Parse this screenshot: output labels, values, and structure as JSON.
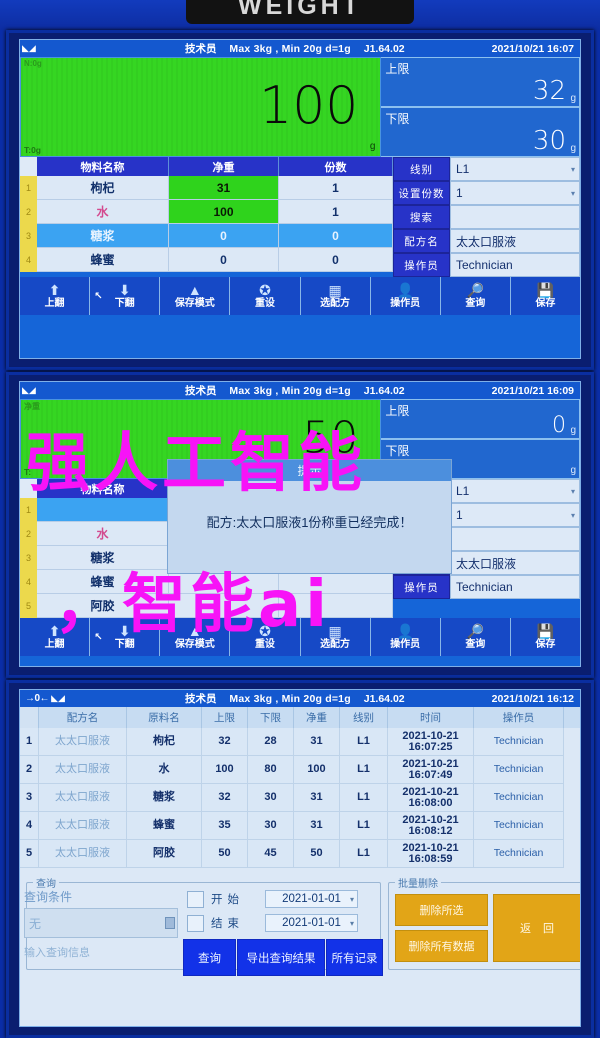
{
  "device": {
    "plate_label": "WEIGHT"
  },
  "common": {
    "status": {
      "zero_indicator": "→0←",
      "level_icon": "level-icon",
      "user": "技术员",
      "spec": "Max 3kg , Min 20g  d=1g",
      "version": "J1.64.02",
      "date": "2021/10/21"
    },
    "toolbar": [
      {
        "label": "上翻",
        "icon": "arrow-up-icon"
      },
      {
        "label": "下翻",
        "icon": "arrow-down-icon"
      },
      {
        "label": "保存模式",
        "icon": "stack-icon"
      },
      {
        "label": "重设",
        "icon": "refresh-icon"
      },
      {
        "label": "选配方",
        "icon": "grid-icon"
      },
      {
        "label": "操作员",
        "icon": "user-icon"
      },
      {
        "label": "查询",
        "icon": "search-doc-icon"
      },
      {
        "label": "保存",
        "icon": "save-plus-icon"
      }
    ],
    "table_headers": {
      "name": "物料名称",
      "net": "净重",
      "qty": "份数"
    },
    "limit_labels": {
      "upper": "上限",
      "lower": "下限"
    },
    "unit": "g",
    "form_labels": {
      "line": "线别",
      "portions": "设置份数",
      "search": "搜索",
      "recipe": "配方名",
      "operator": "操作员"
    }
  },
  "panel1": {
    "time": "16:07",
    "display": {
      "tare": "T:0g",
      "gross_hint": "N:0g",
      "value": "100",
      "unit": "g"
    },
    "limits": {
      "upper": "32",
      "lower": "30"
    },
    "form": {
      "line": "L1",
      "portions": "1",
      "search": "",
      "recipe": "太太口服液",
      "operator": "Technician"
    },
    "rows": [
      {
        "idx": "1",
        "name": "枸杞",
        "net": "31",
        "qty": "1",
        "net_green": true,
        "selected": false
      },
      {
        "idx": "2",
        "name": "水",
        "net": "100",
        "qty": "1",
        "net_green": true,
        "selected": false
      },
      {
        "idx": "3",
        "name": "糖浆",
        "net": "0",
        "qty": "0",
        "net_green": false,
        "selected": true
      },
      {
        "idx": "4",
        "name": "蜂蜜",
        "net": "0",
        "qty": "0",
        "net_green": false,
        "selected": false
      }
    ]
  },
  "panel2": {
    "time": "16:09",
    "display": {
      "tare": "T:",
      "gross_hint": "净重",
      "value": "50",
      "unit": "g"
    },
    "limits": {
      "upper": "0",
      "lower": ""
    },
    "form": {
      "line": "L1",
      "portions": "1",
      "search": "",
      "recipe": "太太口服液",
      "operator": "Technician"
    },
    "rows": [
      {
        "idx": "1",
        "name": "",
        "net": "",
        "qty": "",
        "selected": true
      },
      {
        "idx": "2",
        "name": "水",
        "net": "",
        "qty": "",
        "selected": false
      },
      {
        "idx": "3",
        "name": "糖浆",
        "net": "",
        "qty": "",
        "selected": false
      },
      {
        "idx": "4",
        "name": "蜂蜜",
        "net": "",
        "qty": "",
        "selected": false
      },
      {
        "idx": "5",
        "name": "阿胶",
        "net": "",
        "qty": "",
        "selected": false
      }
    ],
    "dialog": {
      "title": "提示",
      "message": "配方:太太口服液1份称重已经完成！"
    }
  },
  "panel3": {
    "time": "16:12",
    "headers": [
      "配方名",
      "原料名",
      "上限",
      "下限",
      "净重",
      "线别",
      "时间",
      "操作员"
    ],
    "rows": [
      {
        "idx": "1",
        "recipe": "太太口服液",
        "material": "枸杞",
        "upper": "32",
        "lower": "28",
        "net": "31",
        "line": "L1",
        "date": "2021-10-21",
        "time": "16:07:25",
        "operator": "Technician"
      },
      {
        "idx": "2",
        "recipe": "太太口服液",
        "material": "水",
        "upper": "100",
        "lower": "80",
        "net": "100",
        "line": "L1",
        "date": "2021-10-21",
        "time": "16:07:49",
        "operator": "Technician"
      },
      {
        "idx": "3",
        "recipe": "太太口服液",
        "material": "糖浆",
        "upper": "32",
        "lower": "30",
        "net": "31",
        "line": "L1",
        "date": "2021-10-21",
        "time": "16:08:00",
        "operator": "Technician"
      },
      {
        "idx": "4",
        "recipe": "太太口服液",
        "material": "蜂蜜",
        "upper": "35",
        "lower": "30",
        "net": "31",
        "line": "L1",
        "date": "2021-10-21",
        "time": "16:08:12",
        "operator": "Technician"
      },
      {
        "idx": "5",
        "recipe": "太太口服液",
        "material": "阿胶",
        "upper": "50",
        "lower": "45",
        "net": "50",
        "line": "L1",
        "date": "2021-10-21",
        "time": "16:08:59",
        "operator": "Technician"
      }
    ],
    "query": {
      "legend": "查询",
      "condition_label": "查询条件",
      "condition_value": "无",
      "input_placeholder": "输入查询信息",
      "start_label": "开始",
      "end_label": "结束",
      "start_date": "2021-01-01",
      "end_date": "2021-01-01",
      "btn_query": "查询",
      "btn_export": "导出查询结果",
      "btn_all": "所有记录"
    },
    "batch": {
      "legend": "批量删除",
      "btn_delete_selected": "删除所选",
      "btn_delete_all": "删除所有数据",
      "btn_back": "返回"
    }
  },
  "watermark": {
    "line1": "强人工智能",
    "line2": "，智能ai"
  },
  "colors": {
    "accent": "#1232e8",
    "green": "#35d622",
    "amber": "#e2a517",
    "magenta": "#f713f7"
  }
}
